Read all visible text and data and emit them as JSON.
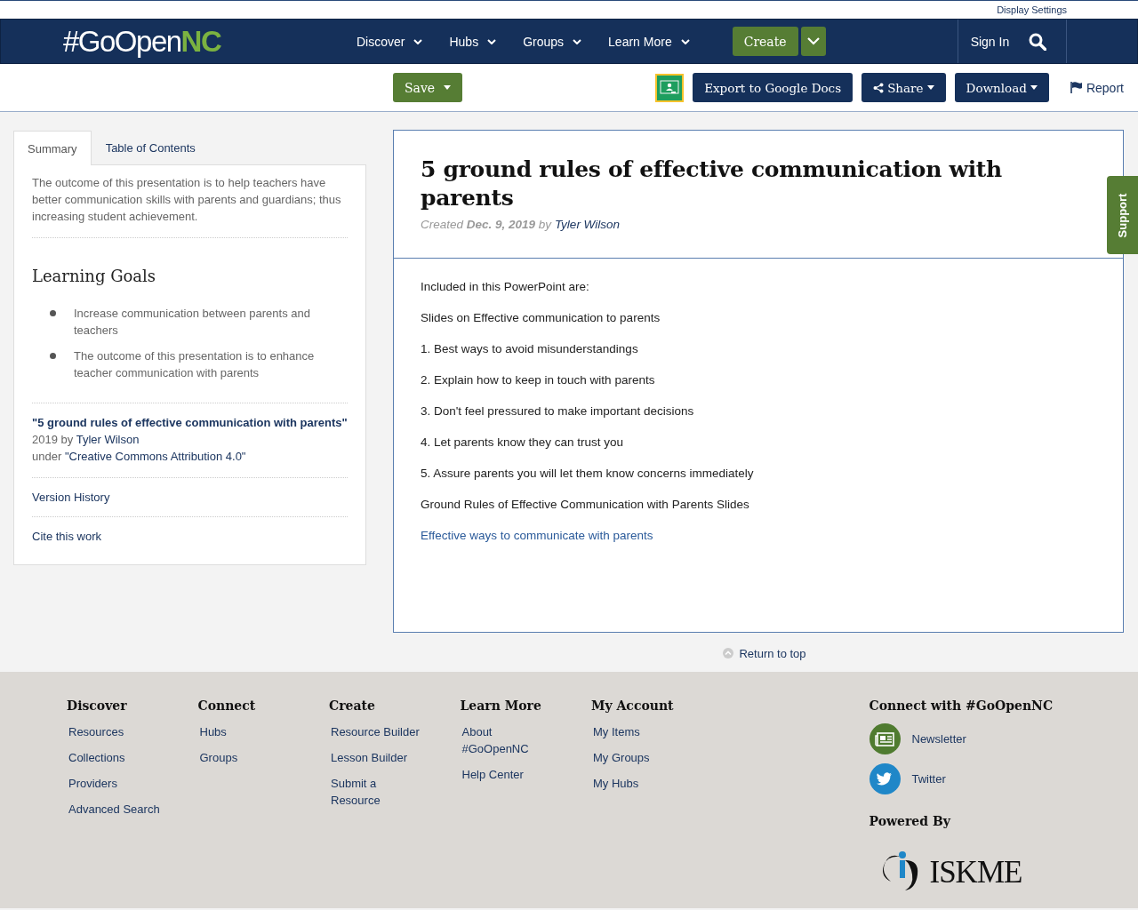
{
  "top_bar": {
    "link": "Display Settings"
  },
  "header": {
    "logo": {
      "main": "#GoOpen",
      "accent": "NC"
    },
    "nav": [
      {
        "label": "Discover"
      },
      {
        "label": "Hubs"
      },
      {
        "label": "Groups"
      },
      {
        "label": "Learn More"
      }
    ],
    "create": "Create",
    "sign_in": "Sign In"
  },
  "toolbar": {
    "save": "Save",
    "export": "Export to Google Docs",
    "share": "Share",
    "download": "Download",
    "report": "Report"
  },
  "sidebar": {
    "tabs": [
      {
        "label": "Summary",
        "selected": true
      },
      {
        "label": "Table of Contents",
        "selected": false
      }
    ],
    "summary": "The outcome of this presentation is to help teachers have better communication skills with parents and guardians; thus increasing student achievement.",
    "goals_heading": "Learning Goals",
    "goals": [
      "Increase communication between parents and teachers",
      "The outcome of this presentation is to enhance teacher communication with parents"
    ],
    "attribution": {
      "title": "\"5 ground rules of effective communication with parents\"",
      "year": "2019 by",
      "author": "Tyler Wilson",
      "under": "under",
      "license": "\"Creative Commons Attribution 4.0\""
    },
    "links": [
      "Version History",
      "Cite this work"
    ]
  },
  "resource": {
    "title": "5 ground rules of effective communication with parents",
    "created": "Created **Dec. 9, 2019** by",
    "author": "Tyler Wilson",
    "body": [
      {
        "kind": "text",
        "text": "Included in this PowerPoint are:"
      },
      {
        "kind": "text",
        "text": "Slides on Effective communication to parents"
      },
      {
        "kind": "text",
        "text": "1. Best ways to avoid misunderstandings"
      },
      {
        "kind": "text",
        "text": "2. Explain how to keep in touch with parents"
      },
      {
        "kind": "text",
        "text": "3. Don't feel pressured to make important decisions"
      },
      {
        "kind": "text",
        "text": "4. Let parents know they can trust you"
      },
      {
        "kind": "text",
        "text": "5. Assure parents you will let them know concerns immediately"
      },
      {
        "kind": "text",
        "text": "Ground Rules of Effective Communication with Parents Slides"
      },
      {
        "kind": "link",
        "text": "Effective ways to communicate with parents"
      }
    ]
  },
  "support_tab": "Support",
  "return_to_top": "Return to top",
  "footer": {
    "columns": [
      {
        "heading": "Discover",
        "links": [
          "Resources",
          "Collections",
          "Providers",
          "Advanced Search"
        ]
      },
      {
        "heading": "Connect",
        "links": [
          "Hubs",
          "Groups"
        ]
      },
      {
        "heading": "Create",
        "links": [
          "Resource Builder",
          "Lesson Builder",
          "Submit a Resource"
        ]
      },
      {
        "heading": "Learn More",
        "links": [
          "About #GoOpenNC",
          "Help Center"
        ]
      },
      {
        "heading": "My Account",
        "links": [
          "My Items",
          "My Groups",
          "My Hubs"
        ]
      }
    ],
    "connect_heading": "Connect with #GoOpenNC",
    "social": [
      {
        "kind": "newsletter",
        "label": "Newsletter",
        "color": "#4f7b2f"
      },
      {
        "kind": "twitter",
        "label": "Twitter",
        "color": "#1f87c8"
      }
    ],
    "powered_by": "Powered By",
    "partner_logo": "ISKME"
  }
}
